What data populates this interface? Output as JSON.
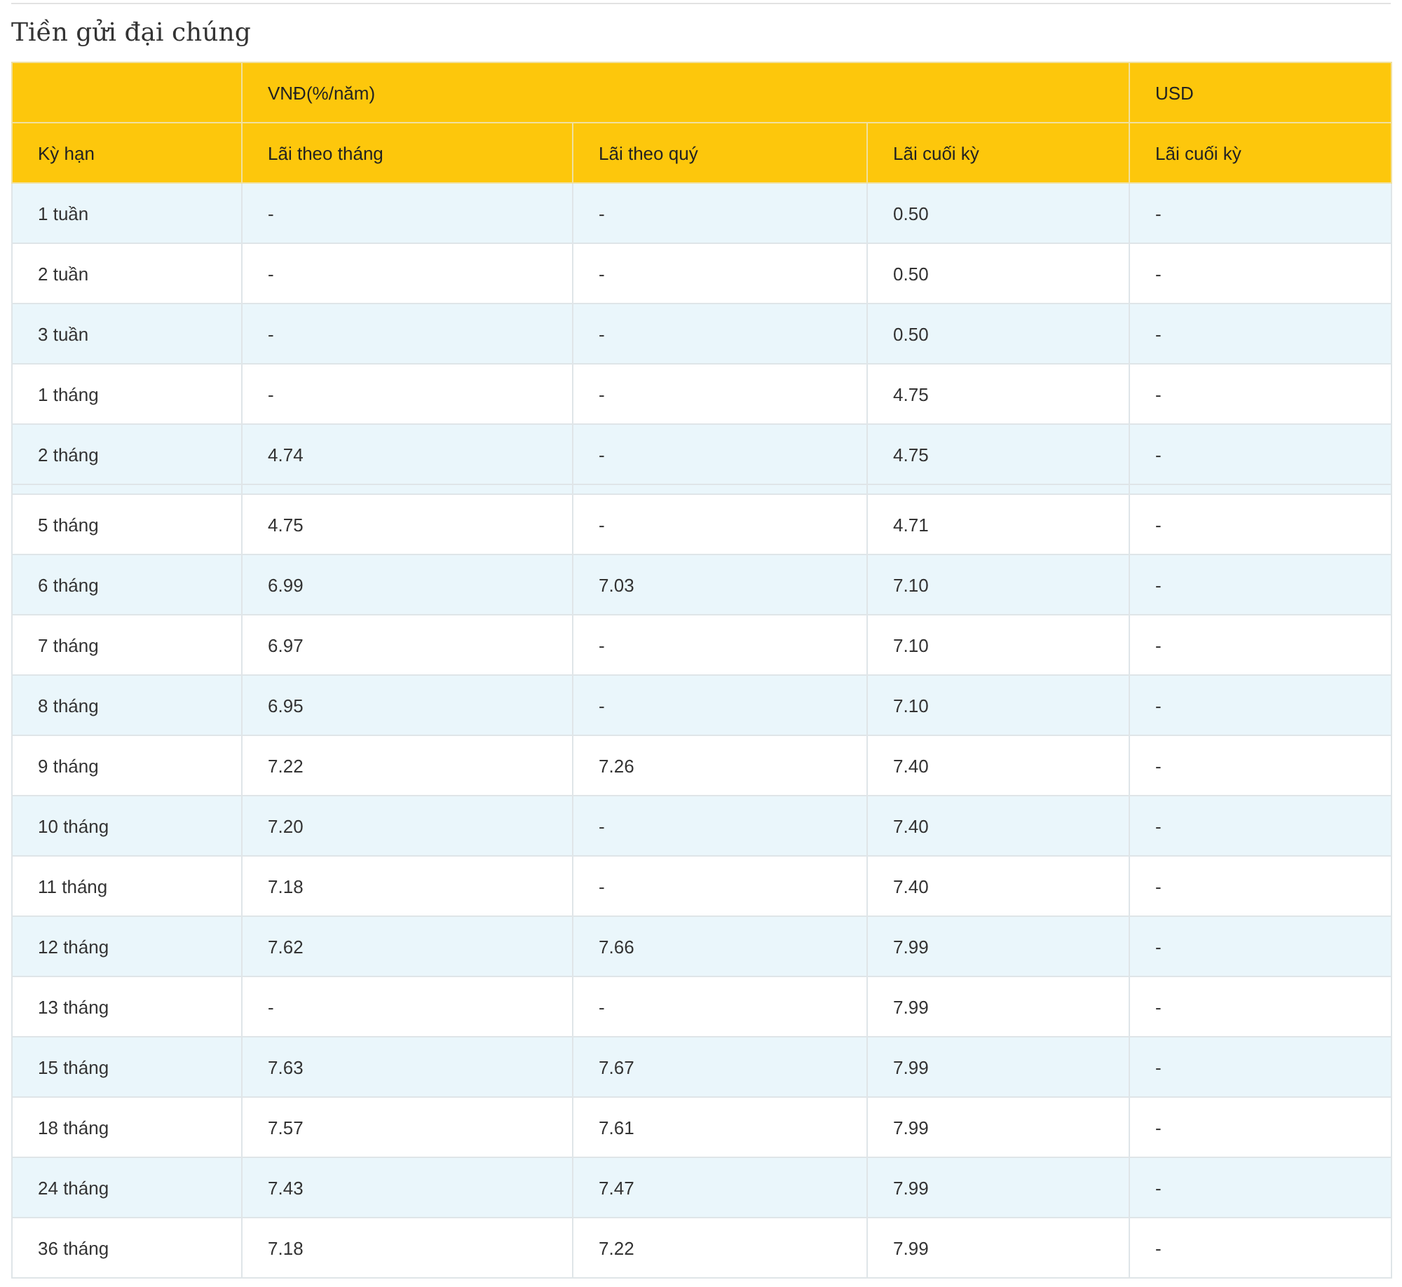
{
  "title": "Tiền gửi đại chúng",
  "table": {
    "group_headers": [
      "VNĐ(%/năm)",
      "USD"
    ],
    "columns": [
      "Kỳ hạn",
      "Lãi theo tháng",
      "Lãi theo quý",
      "Lãi cuối kỳ",
      "Lãi cuối kỳ"
    ],
    "rows": [
      [
        "1 tuần",
        "-",
        "-",
        "0.50",
        "-"
      ],
      [
        "2 tuần",
        "-",
        "-",
        "0.50",
        "-"
      ],
      [
        "3 tuần",
        "-",
        "-",
        "0.50",
        "-"
      ],
      [
        "1 tháng",
        "-",
        "-",
        "4.75",
        "-"
      ],
      [
        "2 tháng",
        "4.74",
        "-",
        "4.75",
        "-"
      ],
      [
        "5 tháng",
        "4.75",
        "-",
        "4.71",
        "-"
      ],
      [
        "6 tháng",
        "6.99",
        "7.03",
        "7.10",
        "-"
      ],
      [
        "7 tháng",
        "6.97",
        "-",
        "7.10",
        "-"
      ],
      [
        "8 tháng",
        "6.95",
        "-",
        "7.10",
        "-"
      ],
      [
        "9 tháng",
        "7.22",
        "7.26",
        "7.40",
        "-"
      ],
      [
        "10 tháng",
        "7.20",
        "-",
        "7.40",
        "-"
      ],
      [
        "11 tháng",
        "7.18",
        "-",
        "7.40",
        "-"
      ],
      [
        "12 tháng",
        "7.62",
        "7.66",
        "7.99",
        "-"
      ],
      [
        "13 tháng",
        "-",
        "-",
        "7.99",
        "-"
      ],
      [
        "15 tháng",
        "7.63",
        "7.67",
        "7.99",
        "-"
      ],
      [
        "18 tháng",
        "7.57",
        "7.61",
        "7.99",
        "-"
      ],
      [
        "24 tháng",
        "7.43",
        "7.47",
        "7.99",
        "-"
      ],
      [
        "36 tháng",
        "7.18",
        "7.22",
        "7.99",
        "-"
      ]
    ]
  }
}
